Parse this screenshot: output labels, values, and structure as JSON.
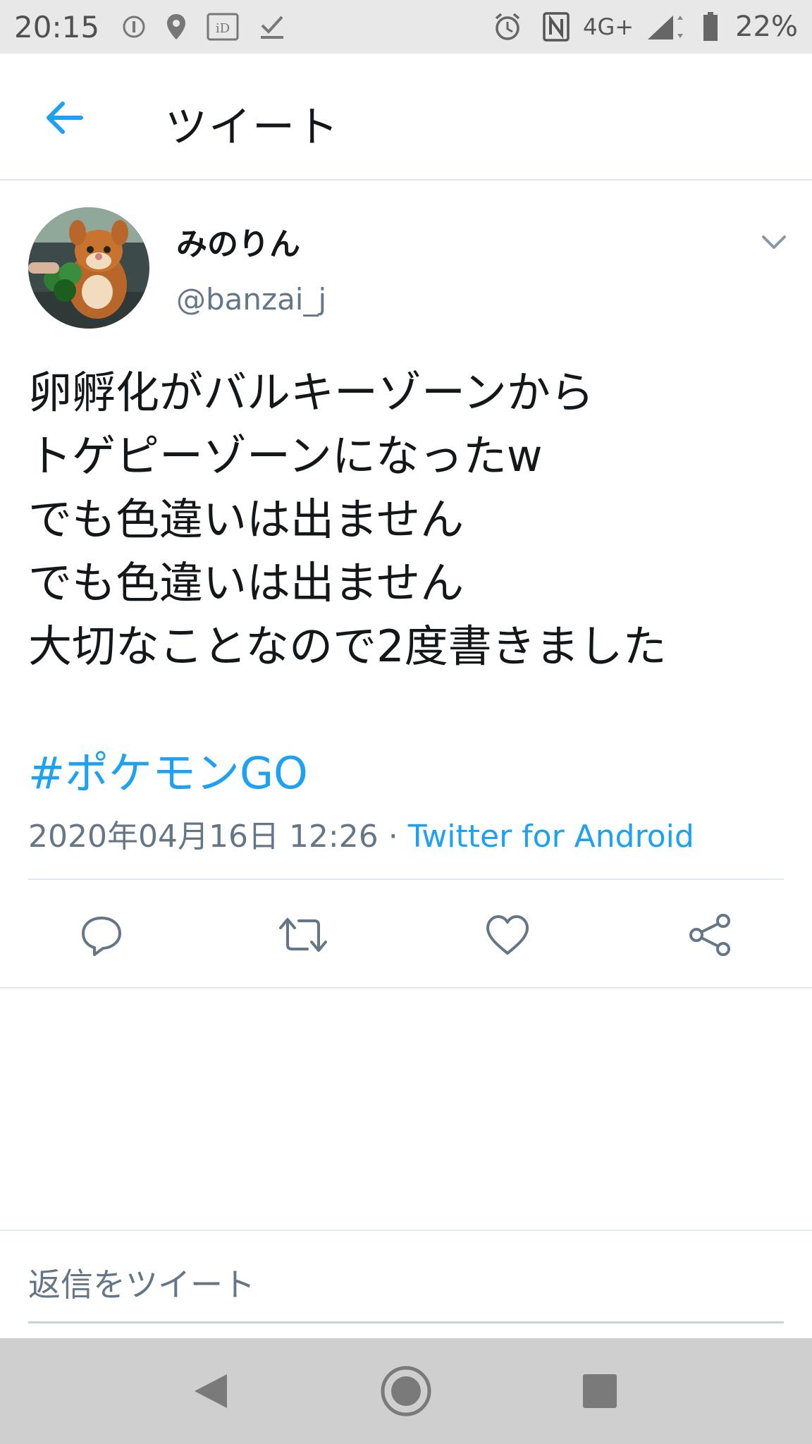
{
  "status_bar": {
    "time": "20:15",
    "network": "4G+",
    "battery": "22%",
    "icons": [
      "info-icon",
      "location-icon",
      "id-icon",
      "download-done-icon",
      "alarm-icon",
      "nfc-icon",
      "signal-icon",
      "battery-icon"
    ]
  },
  "header": {
    "title": "ツイート",
    "back_icon": "arrow-left-icon"
  },
  "tweet": {
    "user_name": "みのりん",
    "user_handle": "@banzai_j",
    "text_lines": [
      "卵孵化がバルキーゾーンから",
      "トゲピーゾーンになったw",
      "でも色違いは出ません",
      "でも色違いは出ません",
      "大切なことなので2度書きました"
    ],
    "hashtag": "#ポケモンGO",
    "timestamp": "2020年04月16日 12:26",
    "separator": " · ",
    "source": "Twitter for Android"
  },
  "actions": [
    "reply-icon",
    "retweet-icon",
    "like-icon",
    "share-icon"
  ],
  "reply_bar": {
    "placeholder": "返信をツイート"
  },
  "nav_bar": [
    "back-triangle-icon",
    "home-circle-icon",
    "recents-square-icon"
  ],
  "colors": {
    "accent": "#1da1f2",
    "text": "#14171a",
    "secondary": "#657786",
    "divider": "#e1e8ed",
    "status_bar_bg": "#e8e8e8",
    "nav_bar_bg": "#cfcfcf"
  }
}
